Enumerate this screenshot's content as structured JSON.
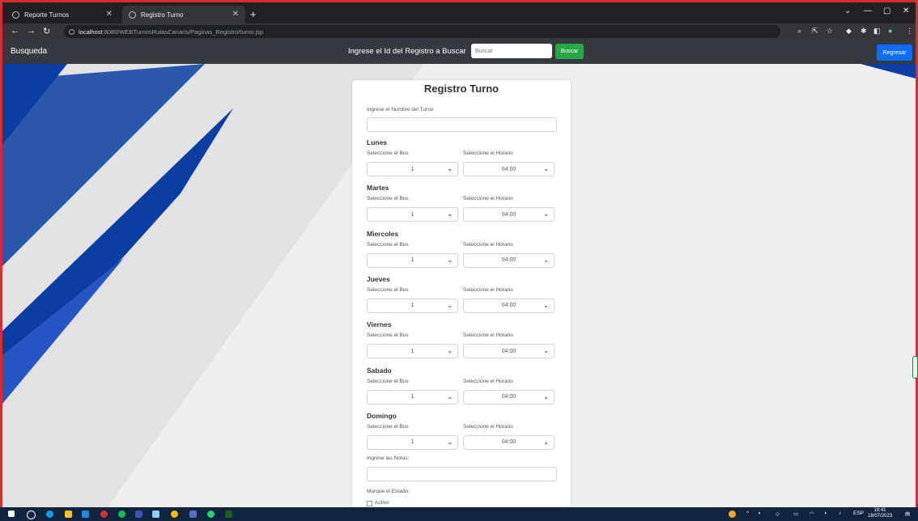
{
  "browser": {
    "tabs": [
      {
        "label": "Reporte Turnos",
        "active": false
      },
      {
        "label": "Registro Turno",
        "active": true
      }
    ],
    "url_host": "localhost",
    "url_rest": ":8080/WEBTurnosRutasCanaris/Paginas_Registro/turno.jsp"
  },
  "navbar": {
    "brand": "Busqueda",
    "search_label": "Ingrese el Id del Registro a Buscar",
    "search_placeholder": "Buscar",
    "search_button": "Buscar",
    "back_button": "Regresar"
  },
  "form": {
    "title": "Registro Turno",
    "name_label": "Ingrese el Nombre del Turno",
    "name_value": "",
    "bus_label": "Seleccione el Bus",
    "time_label": "Seleccione el Horario",
    "days": [
      {
        "name": "Lunes",
        "bus": "1",
        "time": "04:00"
      },
      {
        "name": "Martes",
        "bus": "1",
        "time": "04:00"
      },
      {
        "name": "Miercoles",
        "bus": "1",
        "time": "04:00"
      },
      {
        "name": "Jueves",
        "bus": "1",
        "time": "04:00"
      },
      {
        "name": "Viernes",
        "bus": "1",
        "time": "04:00"
      },
      {
        "name": "Sabado",
        "bus": "1",
        "time": "04:00"
      },
      {
        "name": "Domingo",
        "bus": "1",
        "time": "04:00"
      }
    ],
    "notes_label": "Ingrese las Notas:",
    "notes_value": "",
    "status_label": "Marque el Estado:",
    "status_option": "Activo"
  },
  "taskbar": {
    "language": "ESP",
    "time": "18:41",
    "date": "18/07/2023"
  },
  "colors": {
    "accent_blue": "#0d6efd",
    "success_green": "#28a745",
    "navbar_bg": "#343a40",
    "background_blue": "#0b3ea3"
  }
}
